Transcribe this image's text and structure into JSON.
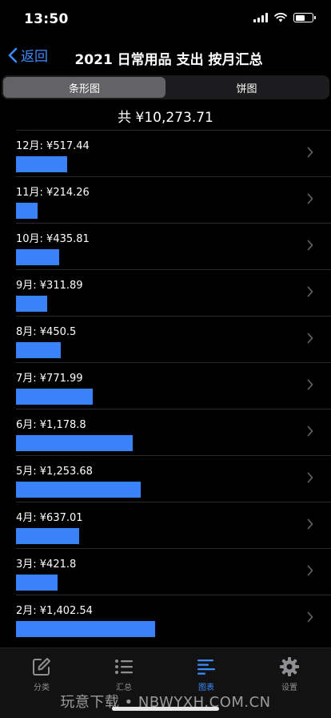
{
  "status_bar": {
    "time": "13:50"
  },
  "nav": {
    "back_label": "返回",
    "title": "2021 日常用品 支出 按月汇总"
  },
  "segments": [
    {
      "label": "条形图",
      "active": true
    },
    {
      "label": "饼图",
      "active": false
    }
  ],
  "total": "共 ¥10,273.71",
  "months": [
    {
      "label": "12月: ¥517.44",
      "value": 517.44
    },
    {
      "label": "11月: ¥214.26",
      "value": 214.26
    },
    {
      "label": "10月: ¥435.81",
      "value": 435.81
    },
    {
      "label": "9月: ¥311.89",
      "value": 311.89
    },
    {
      "label": "8月: ¥450.5",
      "value": 450.5
    },
    {
      "label": "7月: ¥771.99",
      "value": 771.99
    },
    {
      "label": "6月: ¥1,178.8",
      "value": 1178.8
    },
    {
      "label": "5月: ¥1,253.68",
      "value": 1253.68
    },
    {
      "label": "4月: ¥637.01",
      "value": 637.01
    },
    {
      "label": "3月: ¥421.8",
      "value": 421.8
    },
    {
      "label": "2月: ¥1,402.54",
      "value": 1402.54
    }
  ],
  "tabs": [
    {
      "label": "分类",
      "icon": "edit-icon",
      "active": false
    },
    {
      "label": "汇总",
      "icon": "list-icon",
      "active": false
    },
    {
      "label": "图表",
      "icon": "chart-lines-icon",
      "active": true
    },
    {
      "label": "设置",
      "icon": "gear-icon",
      "active": false
    }
  ],
  "watermark": "玩意下载 • NBWYXH.COM.CN",
  "colors": {
    "accent": "#3d8cff",
    "bar": "#3a82f7",
    "background": "#000000"
  }
}
